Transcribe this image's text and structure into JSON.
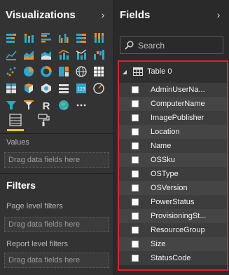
{
  "visualizations": {
    "title": "Visualizations",
    "icons": [
      "stacked-bar-icon",
      "stacked-column-icon",
      "clustered-bar-icon",
      "clustered-column-icon",
      "100-stacked-bar-icon",
      "100-stacked-column-icon",
      "line-chart-icon",
      "area-chart-icon",
      "stacked-area-icon",
      "line-column-icon",
      "line-stacked-column-icon",
      "waterfall-icon",
      "scatter-icon",
      "pie-icon",
      "donut-icon",
      "treemap-icon",
      "map-icon",
      "filled-map-icon",
      "table-icon",
      "matrix-icon",
      "card-icon",
      "multirow-card-icon",
      "kpi-icon",
      "gauge-icon",
      "funnel-icon",
      "slicer-icon",
      "r-visual-icon",
      "globe-icon",
      "more-options-icon"
    ],
    "values_label": "Values",
    "values_drop": "Drag data fields here"
  },
  "filters": {
    "title": "Filters",
    "page_label": "Page level filters",
    "page_drop": "Drag data fields here",
    "report_label": "Report level filters",
    "report_drop": "Drag data fields here"
  },
  "fields": {
    "title": "Fields",
    "search_placeholder": "Search",
    "table_name": "Table 0",
    "items": [
      "AdminUserNa...",
      "ComputerName",
      "ImagePublisher",
      "Location",
      "Name",
      "OSSku",
      "OSType",
      "OSVersion",
      "PowerStatus",
      "ProvisioningSt...",
      "ResourceGroup",
      "Size",
      "StatusCode"
    ]
  },
  "colors": {
    "accent_yellow": "#f2c811",
    "highlight_red": "#d9232f",
    "icon_teal": "#2fa7c9",
    "icon_orange": "#f28b1e"
  }
}
